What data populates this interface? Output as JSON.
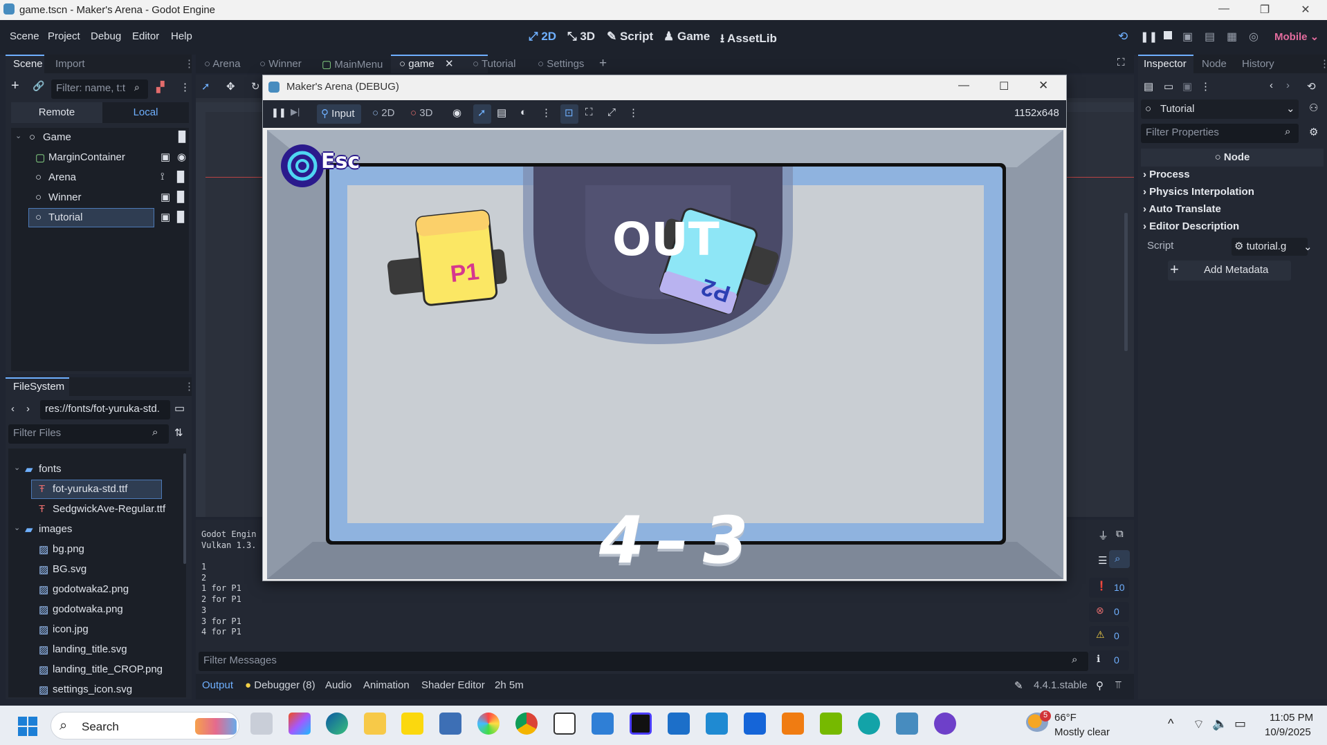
{
  "window": {
    "title": "game.tscn - Maker's Arena - Godot Engine"
  },
  "menubar": {
    "items": [
      "Scene",
      "Project",
      "Debug",
      "Editor",
      "Help"
    ],
    "workspaces": [
      "2D",
      "3D",
      "Script",
      "Game",
      "AssetLib"
    ],
    "renderer": "Mobile"
  },
  "scene_dock": {
    "tabs": [
      "Scene",
      "Import"
    ],
    "filter_placeholder": "Filter: name, t:t",
    "remote": "Remote",
    "local": "Local",
    "nodes": [
      "Game",
      "MarginContainer",
      "Arena",
      "Winner",
      "Tutorial"
    ]
  },
  "editor_tabs": [
    "Arena",
    "Winner",
    "MainMenu",
    "game",
    "Tutorial",
    "Settings"
  ],
  "game_window": {
    "title": "Maker's Arena (DEBUG)",
    "input": "Input",
    "mode_2d": "2D",
    "mode_3d": "3D",
    "resolution": "1152x648",
    "esc": "Esc",
    "out": "OUT",
    "p1": "P1",
    "p2": "P2",
    "score_left": "4",
    "score_sep": "–",
    "score_right": "3"
  },
  "filesystem": {
    "title": "FileSystem",
    "path": "res://fonts/fot-yuruka-std.",
    "filter_placeholder": "Filter Files",
    "items": [
      {
        "name": "fonts",
        "type": "folder"
      },
      {
        "name": "fot-yuruka-std.ttf",
        "type": "font"
      },
      {
        "name": "SedgwickAve-Regular.ttf",
        "type": "font"
      },
      {
        "name": "images",
        "type": "folder"
      },
      {
        "name": "bg.png",
        "type": "image"
      },
      {
        "name": "BG.svg",
        "type": "image"
      },
      {
        "name": "godotwaka2.png",
        "type": "image"
      },
      {
        "name": "godotwaka.png",
        "type": "image"
      },
      {
        "name": "icon.jpg",
        "type": "image"
      },
      {
        "name": "landing_title.svg",
        "type": "image"
      },
      {
        "name": "landing_title_CROP.png",
        "type": "image"
      },
      {
        "name": "settings_icon.svg",
        "type": "image"
      }
    ]
  },
  "output": {
    "lines": [
      "Godot Engin",
      "Vulkan 1.3.",
      "",
      "1",
      "2",
      "1 for P1",
      "2 for P1",
      "3",
      "3 for P1",
      "4 for P1"
    ],
    "filter_placeholder": "Filter Messages",
    "counts": [
      "10",
      "0",
      "0",
      "0"
    ]
  },
  "bottom_tabs": [
    "Output",
    "Debugger (8)",
    "Audio",
    "Animation",
    "Shader Editor",
    "2h 5m"
  ],
  "version": "4.4.1.stable",
  "inspector": {
    "tabs": [
      "Inspector",
      "Node",
      "History"
    ],
    "node_name": "Tutorial",
    "filter_placeholder": "Filter Properties",
    "class_header": "Node",
    "sections": [
      "Process",
      "Physics Interpolation",
      "Auto Translate",
      "Editor Description"
    ],
    "script_label": "Script",
    "script_value": "tutorial.g",
    "add_metadata": "Add Metadata"
  },
  "taskbar": {
    "search": "Search",
    "weather_temp": "66°F",
    "weather_desc": "Mostly clear",
    "weather_badge": "5",
    "time": "11:05 PM",
    "date": "10/9/2025"
  },
  "colors": {
    "accent": "#6fb0ff",
    "game_frame": "#8fb3df",
    "game_inner": "#c9ced3",
    "p1": "#fbe764",
    "p2": "#8ee6f6",
    "score": "#ffffff"
  }
}
